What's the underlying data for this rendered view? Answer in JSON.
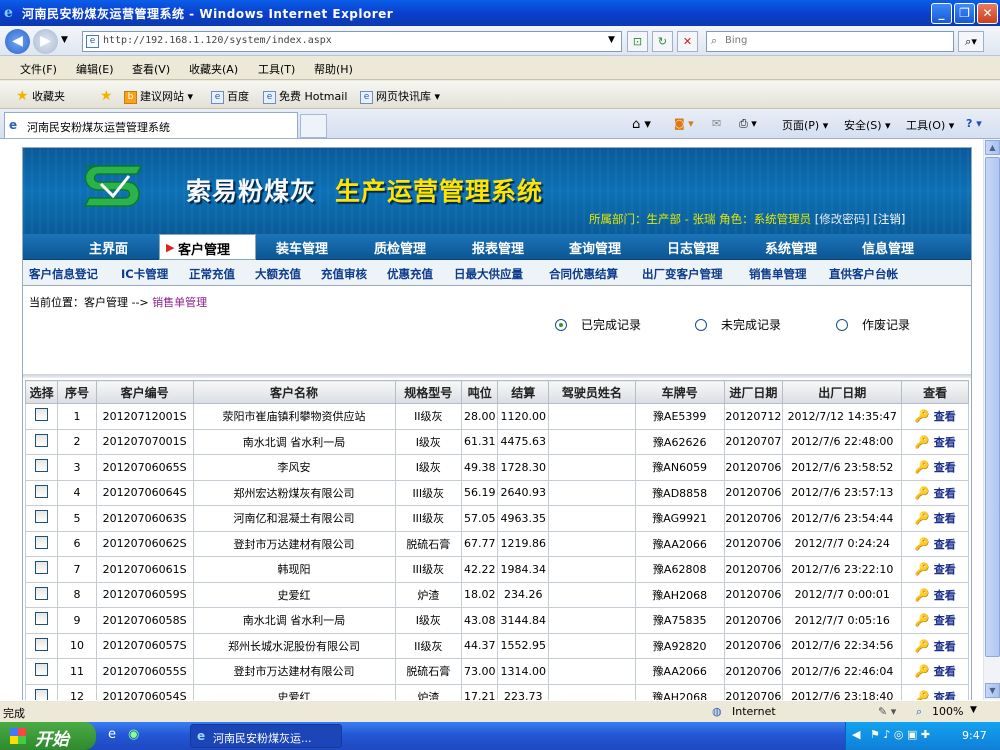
{
  "window": {
    "title": "河南民安粉煤灰运营管理系统 - Windows Internet Explorer"
  },
  "browser": {
    "url": "http://192.168.1.120/system/index.aspx",
    "search_placeholder": "Bing",
    "menu": [
      "文件(F)",
      "编辑(E)",
      "查看(V)",
      "收藏夹(A)",
      "工具(T)",
      "帮助(H)"
    ],
    "favorites_label": "收藏夹",
    "favorites": [
      "建议网站 ▾",
      "百度",
      "免费 Hotmail",
      "网页快讯库 ▾"
    ],
    "tab_title": "河南民安粉煤灰运营管理系统",
    "tab_tools": [
      "页面(P) ▾",
      "安全(S) ▾",
      "工具(O) ▾"
    ],
    "status_left": "完成",
    "status_zone": "Internet",
    "zoom": "100%"
  },
  "app": {
    "brand_white": "索易粉煤灰",
    "brand_yellow": "生产运营管理系统",
    "userinfo": "所属部门：生产部 - 张瑞  角色：系统管理员",
    "change_pwd": "[修改密码]",
    "logout": "[注销]",
    "nav": [
      "主界面",
      "客户管理",
      "装车管理",
      "质检管理",
      "报表管理",
      "查询管理",
      "日志管理",
      "系统管理",
      "信息管理"
    ],
    "subnav": [
      "客户信息登记",
      "IC卡管理",
      "正常充值",
      "大额充值",
      "充值审核",
      "优惠充值",
      "日最大供应量",
      "合同优惠结算",
      "出厂变客户管理",
      "销售单管理",
      "直供客户台帐"
    ],
    "breadcrumb_prefix": "当前位置：客户管理 -->",
    "breadcrumb_current": "销售单管理",
    "radios": [
      {
        "label": "已完成记录",
        "checked": true
      },
      {
        "label": "未完成记录",
        "checked": false
      },
      {
        "label": "作废记录",
        "checked": false
      }
    ]
  },
  "table": {
    "headers": [
      "选择",
      "序号",
      "客户编号",
      "客户名称",
      "规格型号",
      "吨位",
      "结算",
      "驾驶员姓名",
      "车牌号",
      "进厂日期",
      "出厂日期",
      "查看"
    ],
    "view_label": "查看",
    "rows": [
      [
        "1",
        "20120712001S",
        "荥阳市崔庙镇利攀物资供应站",
        "II级灰",
        "28.00",
        "1120.00",
        "",
        "豫AE5399",
        "20120712",
        "2012/7/12 14:35:47"
      ],
      [
        "2",
        "20120707001S",
        "南水北调 省水利一局",
        "I级灰",
        "61.31",
        "4475.63",
        "",
        "豫A62626",
        "20120707",
        "2012/7/6 22:48:00"
      ],
      [
        "3",
        "20120706065S",
        "李风安",
        "I级灰",
        "49.38",
        "1728.30",
        "",
        "豫AN6059",
        "20120706",
        "2012/7/6 23:58:52"
      ],
      [
        "4",
        "20120706064S",
        "郑州宏达粉煤灰有限公司",
        "III级灰",
        "56.19",
        "2640.93",
        "",
        "豫AD8858",
        "20120706",
        "2012/7/6 23:57:13"
      ],
      [
        "5",
        "20120706063S",
        "河南亿和混凝土有限公司",
        "III级灰",
        "57.05",
        "4963.35",
        "",
        "豫AG9921",
        "20120706",
        "2012/7/6 23:54:44"
      ],
      [
        "6",
        "20120706062S",
        "登封市万达建材有限公司",
        "脱硫石膏",
        "67.77",
        "1219.86",
        "",
        "豫AA2066",
        "20120706",
        "2012/7/7 0:24:24"
      ],
      [
        "7",
        "20120706061S",
        "韩现阳",
        "III级灰",
        "42.22",
        "1984.34",
        "",
        "豫A62808",
        "20120706",
        "2012/7/6 23:22:10"
      ],
      [
        "8",
        "20120706059S",
        "史爱红",
        "炉渣",
        "18.02",
        "234.26",
        "",
        "豫AH2068",
        "20120706",
        "2012/7/7 0:00:01"
      ],
      [
        "9",
        "20120706058S",
        "南水北调 省水利一局",
        "I级灰",
        "43.08",
        "3144.84",
        "",
        "豫A75835",
        "20120706",
        "2012/7/7 0:05:16"
      ],
      [
        "10",
        "20120706057S",
        "郑州长城水泥股份有限公司",
        "II级灰",
        "44.37",
        "1552.95",
        "",
        "豫A92820",
        "20120706",
        "2012/7/6 22:34:56"
      ],
      [
        "11",
        "20120706055S",
        "登封市万达建材有限公司",
        "脱硫石膏",
        "73.00",
        "1314.00",
        "",
        "豫AA2066",
        "20120706",
        "2012/7/6 22:46:04"
      ],
      [
        "12",
        "20120706054S",
        "史爱红",
        "炉渣",
        "17.21",
        "223.73",
        "",
        "豫AH2068",
        "20120706",
        "2012/7/6 23:18:40"
      ]
    ]
  },
  "taskbar": {
    "start": "开始",
    "task": "河南民安粉煤灰运...",
    "clock": "9:47"
  }
}
